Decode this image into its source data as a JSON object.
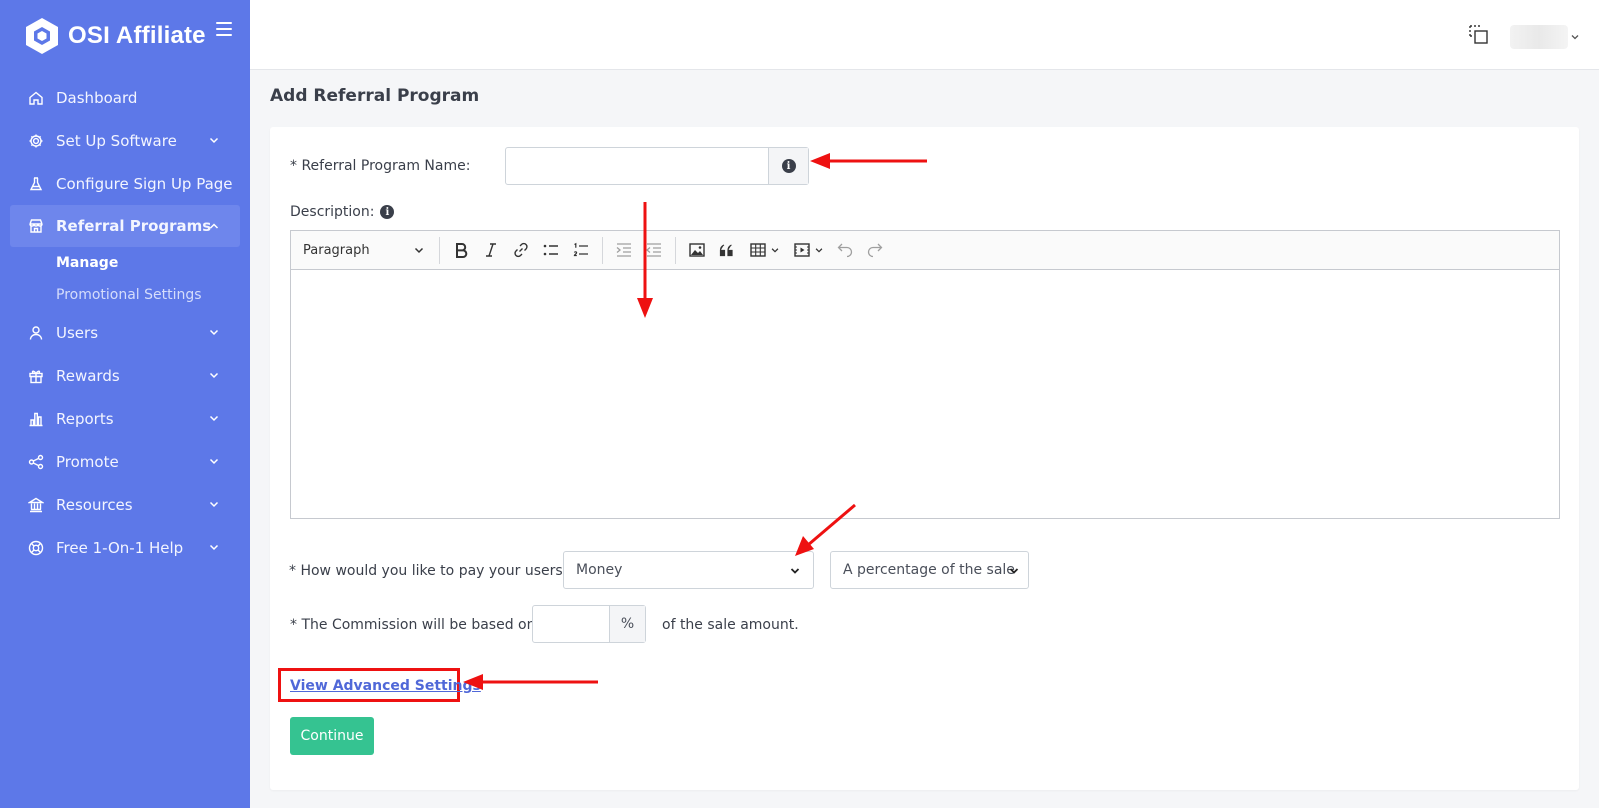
{
  "brand": {
    "name": "OSI Affiliate"
  },
  "sidebar": {
    "items": [
      {
        "label": "Dashboard",
        "icon": "home-icon"
      },
      {
        "label": "Set Up Software",
        "icon": "gear-icon"
      },
      {
        "label": "Configure Sign Up Page",
        "icon": "flask-icon"
      },
      {
        "label": "Referral Programs",
        "icon": "store-icon"
      },
      {
        "label": "Users",
        "icon": "user-icon"
      },
      {
        "label": "Rewards",
        "icon": "gift-icon"
      },
      {
        "label": "Reports",
        "icon": "bar-chart-icon"
      },
      {
        "label": "Promote",
        "icon": "share-icon"
      },
      {
        "label": "Resources",
        "icon": "bank-icon"
      },
      {
        "label": "Free 1-On-1 Help",
        "icon": "lifebuoy-icon"
      }
    ],
    "sub_items": [
      {
        "label": "Manage"
      },
      {
        "label": "Promotional Settings"
      }
    ]
  },
  "page": {
    "title": "Add Referral Program"
  },
  "form": {
    "name_label": "* Referral Program Name:",
    "name_value": "",
    "description_label": "Description:",
    "editor": {
      "block_format": "Paragraph"
    },
    "pay_label": "* How would you like to pay your users:",
    "pay_type": "Money",
    "pay_basis": "A percentage of the sale",
    "commission_label": "* The Commission will be based on",
    "commission_value": "",
    "commission_unit": "%",
    "commission_suffix": "of the sale amount.",
    "advanced_link": "View Advanced Settings",
    "continue_label": "Continue"
  },
  "annotations": {
    "color": "#ee1111"
  }
}
